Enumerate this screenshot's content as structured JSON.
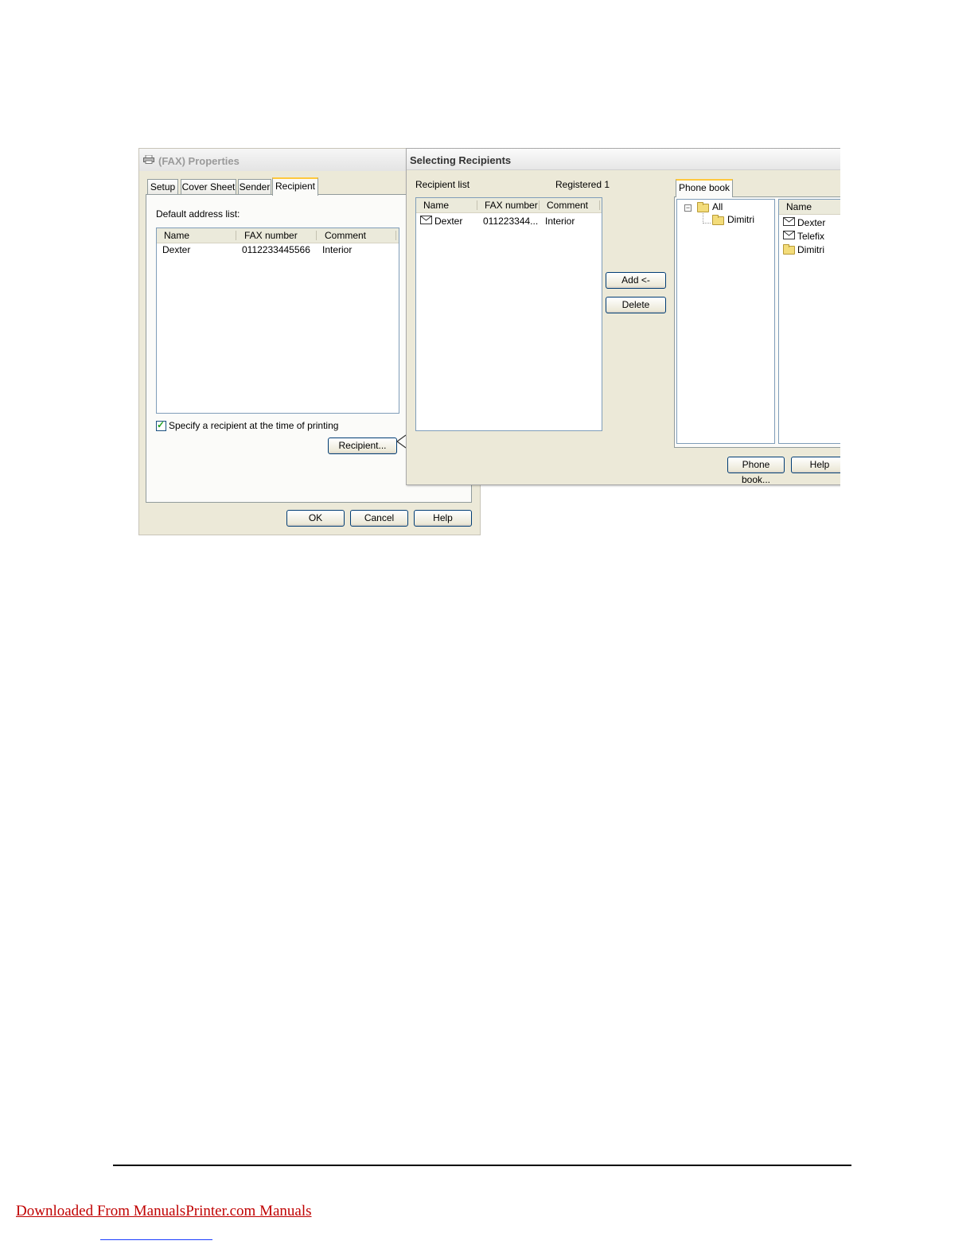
{
  "properties_dialog": {
    "title": "(FAX) Properties",
    "tabs": [
      {
        "label": "Setup",
        "active": false
      },
      {
        "label": "Cover Sheet",
        "active": false
      },
      {
        "label": "Sender",
        "active": false
      },
      {
        "label": "Recipient",
        "active": true
      }
    ],
    "default_address_label": "Default address list:",
    "columns": [
      "Name",
      "FAX number",
      "Comment"
    ],
    "rows": [
      {
        "name": "Dexter",
        "fax": "0112233445566",
        "comment": "Interior"
      }
    ],
    "specify_checkbox": {
      "label": "Specify a recipient at the time of printing",
      "checked": true
    },
    "recipient_button": "Recipient...",
    "ok_button": "OK",
    "cancel_button": "Cancel",
    "help_button": "Help"
  },
  "selecting_dialog": {
    "title": "Selecting Recipients",
    "recipient_list_label": "Recipient list",
    "registered_label": "Registered 1",
    "columns": [
      "Name",
      "FAX number",
      "Comment"
    ],
    "rows": [
      {
        "icon": "mail-icon",
        "name": "Dexter",
        "fax": "011223344...",
        "comment": "Interior"
      }
    ],
    "add_button": "Add <-",
    "delete_button": "Delete",
    "phonebook_tab": "Phone book",
    "tree": [
      {
        "label": "All",
        "icon": "folder-icon",
        "expanded": true
      },
      {
        "label": "Dimitri",
        "icon": "folder-icon"
      }
    ],
    "name_column": "Name",
    "phonebook_items": [
      {
        "label": "Dexter",
        "icon": "mail-icon"
      },
      {
        "label": "Telefix",
        "icon": "mail-icon"
      },
      {
        "label": "Dimitri",
        "icon": "folder-icon"
      }
    ],
    "phonebook_button": "Phone book...",
    "help_button": "Help"
  },
  "footer": {
    "link_text": "Downloaded From ManualsPrinter.com Manuals"
  },
  "colors": {
    "dialog_bg": "#ece9d8",
    "button_border": "#003c74",
    "active_tab_accent": "#ffc83c",
    "footer_link": "#c00000"
  }
}
